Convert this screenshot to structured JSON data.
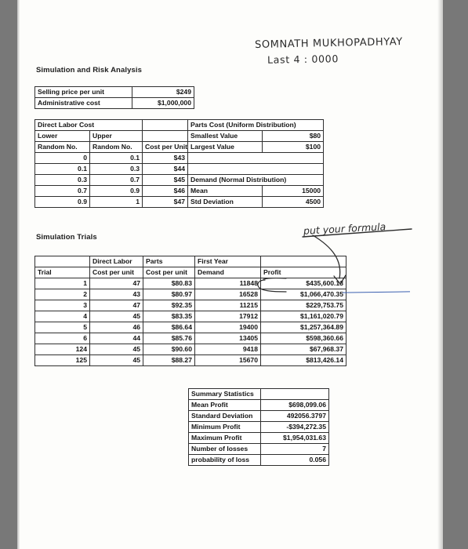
{
  "page": {
    "heading_1": "Simulation and Risk Analysis",
    "heading_2": "Simulation Trials"
  },
  "inputs": {
    "rows": [
      {
        "label": "Selling price per unit",
        "value": "$249"
      },
      {
        "label": "Administrative cost",
        "value": "$1,000,000"
      }
    ]
  },
  "direct_labor": {
    "title": "Direct Labor Cost",
    "header_a": [
      "Lower",
      "Upper",
      ""
    ],
    "header_b": [
      "Random No.",
      "Random No.",
      "Cost per Unit"
    ],
    "rows": [
      {
        "lower": "0",
        "upper": "0.1",
        "cost": "$43"
      },
      {
        "lower": "0.1",
        "upper": "0.3",
        "cost": "$44"
      },
      {
        "lower": "0.3",
        "upper": "0.7",
        "cost": "$45"
      },
      {
        "lower": "0.7",
        "upper": "0.9",
        "cost": "$46"
      },
      {
        "lower": "0.9",
        "upper": "1",
        "cost": "$47"
      }
    ]
  },
  "parts_cost": {
    "title": "Parts Cost (Uniform Distribution)",
    "rows": [
      {
        "label": "Smallest Value",
        "value": "$80"
      },
      {
        "label": "Largest Value",
        "value": "$100"
      }
    ]
  },
  "demand": {
    "title": "Demand (Normal Distribution)",
    "rows": [
      {
        "label": "Mean",
        "value": "15000"
      },
      {
        "label": "Std Deviation",
        "value": "4500"
      }
    ]
  },
  "trials": {
    "header_a": [
      "",
      "Direct Labor",
      "Parts",
      "First Year",
      ""
    ],
    "header_b": [
      "Trial",
      "Cost per unit",
      "Cost per unit",
      "Demand",
      "Profit"
    ],
    "rows": [
      {
        "trial": "1",
        "labor": "47",
        "parts": "$80.83",
        "demand": "11848",
        "profit": "$435,600.13"
      },
      {
        "trial": "2",
        "labor": "43",
        "parts": "$80.97",
        "demand": "16528",
        "profit": "$1,066,470.35"
      },
      {
        "trial": "3",
        "labor": "47",
        "parts": "$92.35",
        "demand": "11215",
        "profit": "$229,753.75"
      },
      {
        "trial": "4",
        "labor": "45",
        "parts": "$83.35",
        "demand": "17912",
        "profit": "$1,161,020.79"
      },
      {
        "trial": "5",
        "labor": "46",
        "parts": "$86.64",
        "demand": "19400",
        "profit": "$1,257,364.89"
      },
      {
        "trial": "6",
        "labor": "44",
        "parts": "$85.76",
        "demand": "13405",
        "profit": "$598,360.66"
      },
      {
        "trial": "124",
        "labor": "45",
        "parts": "$90.60",
        "demand": "9418",
        "profit": "$67,968.37"
      },
      {
        "trial": "125",
        "labor": "45",
        "parts": "$88.27",
        "demand": "15670",
        "profit": "$813,426.14"
      }
    ]
  },
  "summary": {
    "title": "Summary Statistics",
    "rows": [
      {
        "label": "Mean Profit",
        "value": "$698,099.06"
      },
      {
        "label": "Standard Deviation",
        "value": "492056.3797"
      },
      {
        "label": "Minimum Profit",
        "value": "-$394,272.35"
      },
      {
        "label": "Maximum Profit",
        "value": "$1,954,031.63"
      },
      {
        "label": "Number of losses",
        "value": "7"
      },
      {
        "label": "probability of loss",
        "value": "0.056"
      }
    ]
  },
  "annotations": {
    "student_name": "SOMNATH MUKHOPADHYAY",
    "last4": "Last 4 :  0000",
    "formula_note": "put your formula",
    "ink_color": "#2b2b2b",
    "highlight_color": "#3a5fb0"
  }
}
